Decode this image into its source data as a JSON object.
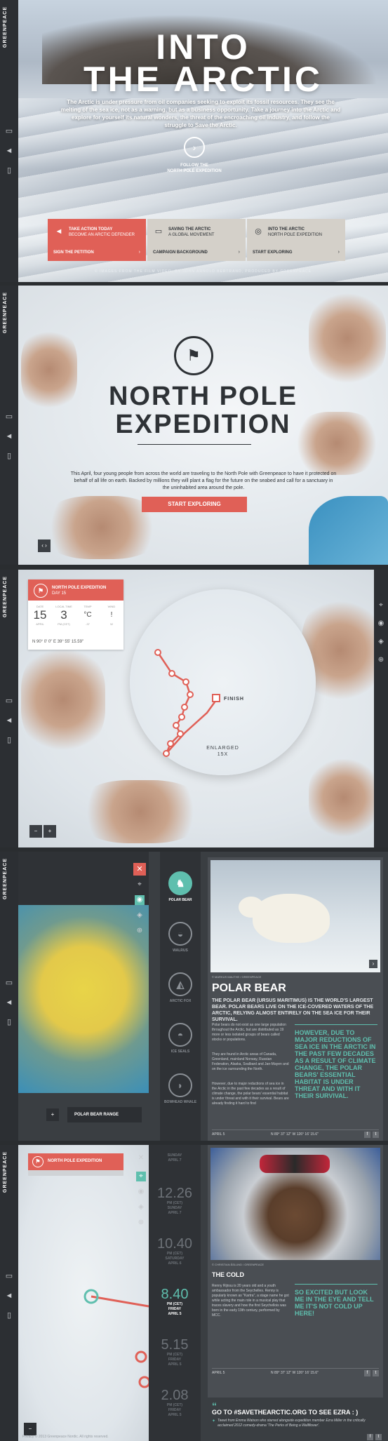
{
  "brand": {
    "logo": "GREENPEACE",
    "accent": "#e06057",
    "teal": "#5fbfae",
    "dark": "#2c2f33"
  },
  "sidebar": {
    "icons": [
      "map-icon",
      "megaphone-icon",
      "book-icon"
    ]
  },
  "hero": {
    "title_line1": "INTO",
    "title_line2": "THE ARCTIC",
    "text": "The Arctic is under pressure from oil companies seeking to exploit its fossil resources. They see the melting of the sea ice, not as a warning, but as a business opportunity. Take a journey into the Arctic and explore for yourself its natural wonders, the threat of the encroaching oil industry, and follow the struggle to Save the Arctic.",
    "follow_label_1": "FOLLOW THE",
    "follow_label_2": "NORTH POLE EXPEDITION",
    "cards": [
      {
        "title": "TAKE ACTION TODAY",
        "subtitle": "BECOME AN ARCTIC DEFENDER",
        "link": "SIGN THE PETITION"
      },
      {
        "title": "SAVING THE ARCTIC",
        "subtitle": "A GLOBAL MOVEMENT",
        "link": "CAMPAIGN BACKGROUND"
      },
      {
        "title": "INTO THE ARCTIC",
        "subtitle": "NORTH POLE EXPEDITION",
        "link": "START EXPLORING"
      }
    ],
    "credits": "© IMAGES FROM THE FILM VIDEO, BY JOHN ARNOLD BERTRAND, PRODUCED BY GREENPEACE"
  },
  "expedition": {
    "title_line1": "NORTH POLE",
    "title_line2": "EXPEDITION",
    "text": "This April, four young people from across the world are traveling to the North Pole with Greenpeace to have it protected on behalf of all life on earth. Backed by millions they will plant a flag for the future on the seabed and call for a sanctuary in the uninhabited area around the pole.",
    "button": "START EXPLORING",
    "nav_btn": "‹ ›"
  },
  "tracker": {
    "box_title": "NORTH POLE EXPEDITION",
    "box_subtitle": "DAY 15",
    "stats": [
      {
        "label": "DATE",
        "value": "15",
        "sub": "APRIL"
      },
      {
        "label": "LOCAL TIME",
        "value": "3",
        "sub": "PM (CET)"
      },
      {
        "label": "TEMP",
        "value": "°C",
        "sub": "-37"
      },
      {
        "label": "WIND",
        "value": "!",
        "sub": "W"
      }
    ],
    "coords": "N 90° 0' 0\"   E 39° 55' 15.59\"",
    "finish_label": "FINISH",
    "enlarged_label_1": "ENLARGED",
    "enlarged_label_2": "15X",
    "zoom_out": "−",
    "zoom_in": "+"
  },
  "wildlife": {
    "range_label": "POLAR BEAR RANGE",
    "add_btn": "+",
    "animals": [
      {
        "name": "POLAR BEAR",
        "icon": "polar-bear-icon"
      },
      {
        "name": "WALRUS",
        "icon": "walrus-icon"
      },
      {
        "name": "ARCTIC FOX",
        "icon": "fox-icon"
      },
      {
        "name": "ICE SEALS",
        "icon": "seal-icon"
      },
      {
        "name": "BOWHEAD WHALE",
        "icon": "whale-icon"
      }
    ],
    "article": {
      "credit": "© MARKUS MAUTHE / GREENPEACE",
      "title": "POLAR BEAR",
      "lead": "THE POLAR BEAR (URSUS MARITIMUS) IS THE WORLD'S LARGEST BEAR. POLAR BEARS LIVE ON THE ICE-COVERED WATERS OF THE ARCTIC, RELYING ALMOST ENTIRELY ON THE SEA ICE FOR THEIR SURVIVAL.",
      "body1": "Polar bears do not exist as one large population throughout the Arctic, but are distributed as 19 more or less isolated groups of bears called stocks or populations.",
      "body2": "They are found in Arctic areas of Canada, Greenland, mainland Norway, Russian Federation, Alaska, Svalbard and Jan-Mayen and on the ice surrounding the North.",
      "body3": "However, due to major reductions of sea ice in the Arctic in the past few decades as a result of climate change, the polar bears' essential habitat is under threat and with it their survival. Bears are already finding it hard to find",
      "quote": "HOWEVER, DUE TO MAJOR REDUCTIONS OF SEA ICE IN THE ARCTIC IN THE PAST FEW DECADES AS A RESULT OF CLIMATE CHANGE, THE POLAR BEARS' ESSENTIAL HABITAT IS UNDER THREAT AND WITH IT THEIR SURVIVAL.",
      "date": "APRIL 5",
      "coords": "N 89° 37' 12\" W 126° 16' 15.6\""
    }
  },
  "timeline": {
    "box_title": "NORTH POLE EXPEDITION",
    "entries": [
      {
        "time": "",
        "sub1": "SUNDAY",
        "sub2": "APRIL 7"
      },
      {
        "time": "12.26",
        "sub1": "PM (CET)",
        "sub2": "SUNDAY\nAPRIL 7"
      },
      {
        "time": "10.40",
        "sub1": "PM (CET)",
        "sub2": "SATURDAY\nAPRIL 6"
      },
      {
        "time": "8.40",
        "sub1": "PM (CET)",
        "sub2": "FRIDAY\nAPRIL 5"
      },
      {
        "time": "5.15",
        "sub1": "PM (CET)",
        "sub2": "FRIDAY\nAPRIL 5"
      },
      {
        "time": "2.08",
        "sub1": "PM (CET)",
        "sub2": "FRIDAY\nAPRIL 5"
      }
    ],
    "article": {
      "credit": "© CHRISTIAN ÅSLUND / GREENPEACE",
      "title": "THE COLD",
      "body": "Renny Rijnsu is 20 years old and a youth ambassador from the Seychelles. Renny is popularly known as \"Kartra\", a stage name he got while acting the main role in a musical play that traces slavery and how the first Seychellois was born in the early 19th century, performed by MCC.",
      "quote": "SO EXCITED BUT LOOK ME IN THE EYE AND TELL ME IT'S NOT COLD UP HERE!",
      "date": "APRIL 5",
      "coords": "N 89° 37' 12\" W 126° 16' 15.6\""
    },
    "cta": "GO TO #SAVETHEARCTIC.ORG TO SEE EZRA : )",
    "tweet": "Tweet from Emma Watson who starred alongside expedition member Ezra Miller in the critically acclaimed 2012 comedy-drama 'The Perks of Being a Wallflower'."
  },
  "footer": {
    "text": "Privacy  © 2013 Greenpeace Nordic. All rights reserved."
  }
}
